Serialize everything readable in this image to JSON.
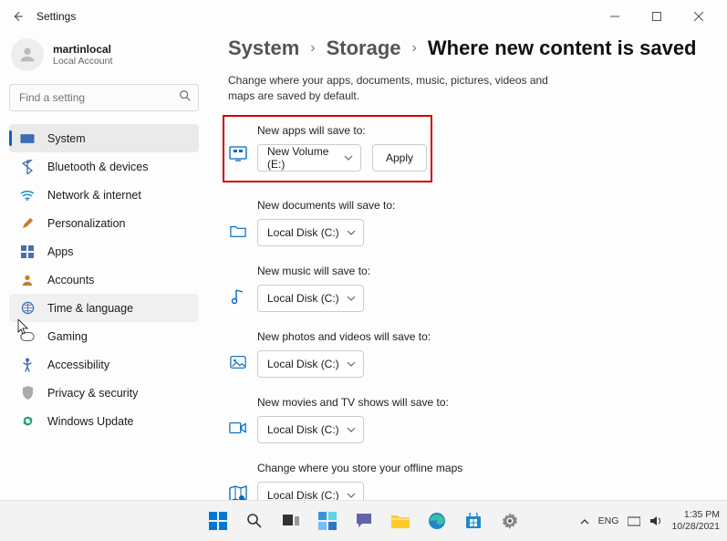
{
  "window": {
    "title": "Settings"
  },
  "user": {
    "name": "martinlocal",
    "type": "Local Account"
  },
  "search": {
    "placeholder": "Find a setting"
  },
  "nav": [
    {
      "label": "System"
    },
    {
      "label": "Bluetooth & devices"
    },
    {
      "label": "Network & internet"
    },
    {
      "label": "Personalization"
    },
    {
      "label": "Apps"
    },
    {
      "label": "Accounts"
    },
    {
      "label": "Time & language"
    },
    {
      "label": "Gaming"
    },
    {
      "label": "Accessibility"
    },
    {
      "label": "Privacy & security"
    },
    {
      "label": "Windows Update"
    }
  ],
  "breadcrumb": {
    "level1": "System",
    "level2": "Storage",
    "current": "Where new content is saved"
  },
  "description": "Change where your apps, documents, music, pictures, videos and maps are saved by default.",
  "rows": {
    "apps": {
      "label": "New apps will save to:",
      "value": "New Volume (E:)",
      "apply": "Apply"
    },
    "docs": {
      "label": "New documents will save to:",
      "value": "Local Disk (C:)"
    },
    "music": {
      "label": "New music will save to:",
      "value": "Local Disk (C:)"
    },
    "photos": {
      "label": "New photos and videos will save to:",
      "value": "Local Disk (C:)"
    },
    "movies": {
      "label": "New movies and TV shows will save to:",
      "value": "Local Disk (C:)"
    },
    "maps": {
      "label": "Change where you store your offline maps",
      "value": "Local Disk (C:)"
    }
  },
  "taskbar": {
    "lang": "ENG",
    "time": "1:35 PM",
    "date": "10/28/2021"
  }
}
